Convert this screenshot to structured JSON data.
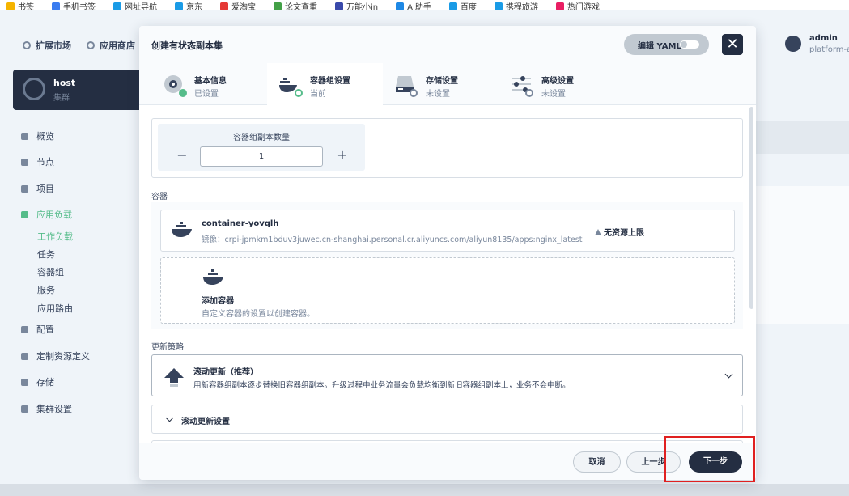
{
  "bookmarks": [
    {
      "label": "书签",
      "color": "#f5b400"
    },
    {
      "label": "手机书签",
      "color": "#3a7cf0"
    },
    {
      "label": "网址导航",
      "color": "#1a9be6"
    },
    {
      "label": "京东",
      "color": "#1a9be6"
    },
    {
      "label": "爱淘宝",
      "color": "#e53935"
    },
    {
      "label": "论文查重",
      "color": "#43a047"
    },
    {
      "label": "万能小in",
      "color": "#3949ab"
    },
    {
      "label": "AI助手",
      "color": "#1e88e5"
    },
    {
      "label": "百度",
      "color": "#1a9be6"
    },
    {
      "label": "携程旅游",
      "color": "#1a9be6"
    },
    {
      "label": "热门游戏",
      "color": "#e91e63"
    }
  ],
  "topnav": {
    "extensions": "扩展市场",
    "app_store": "应用商店"
  },
  "user": {
    "name": "admin",
    "role": "platform-ad"
  },
  "cluster": {
    "name": "host",
    "label": "集群"
  },
  "sidebar": {
    "items": [
      {
        "label": "概览",
        "active": false
      },
      {
        "label": "节点",
        "active": false
      },
      {
        "label": "项目",
        "active": false
      },
      {
        "label": "应用负载",
        "active": true
      },
      {
        "label": "配置",
        "active": false
      },
      {
        "label": "定制资源定义",
        "active": false
      },
      {
        "label": "存储",
        "active": false
      },
      {
        "label": "集群设置",
        "active": false
      }
    ],
    "subitems": [
      {
        "label": "工作负载",
        "active": true
      },
      {
        "label": "任务",
        "active": false
      },
      {
        "label": "容器组",
        "active": false
      },
      {
        "label": "服务",
        "active": false
      },
      {
        "label": "应用路由",
        "active": false
      }
    ]
  },
  "modal": {
    "title": "创建有状态副本集",
    "edit_yaml": "编辑 YAML",
    "close_symbol": "✕"
  },
  "steps": [
    {
      "name": "基本信息",
      "status": "已设置",
      "state": "done"
    },
    {
      "name": "容器组设置",
      "status": "当前",
      "state": "current"
    },
    {
      "name": "存储设置",
      "status": "未设置",
      "state": "todo"
    },
    {
      "name": "高级设置",
      "status": "未设置",
      "state": "todo"
    }
  ],
  "replicas": {
    "label": "容器组副本数量",
    "value": "1",
    "minus": "−",
    "plus": "+"
  },
  "containers": {
    "section_label": "容器",
    "items": [
      {
        "name": "container-yovqlh",
        "image": "镜像：crpi-jpmkm1bduv3juwec.cn-shanghai.personal.cr.aliyuncs.com/aliyun8135/apps:nginx_latest",
        "limit": "无资源上限"
      }
    ],
    "add_title": "添加容器",
    "add_desc": "自定义容器的设置以创建容器。"
  },
  "strategy": {
    "section_label": "更新策略",
    "name": "滚动更新（推荐）",
    "desc": "用新容器组副本逐步替换旧容器组副本。升级过程中业务流量会负载均衡到新旧容器组副本上，业务不会中断。"
  },
  "rolling": {
    "label": "滚动更新设置"
  },
  "footer": {
    "cancel": "取消",
    "prev": "上一步",
    "next": "下一步"
  },
  "colors": {
    "accent": "#55bc8a",
    "dark": "#242e42",
    "highlight": "#e02020"
  }
}
